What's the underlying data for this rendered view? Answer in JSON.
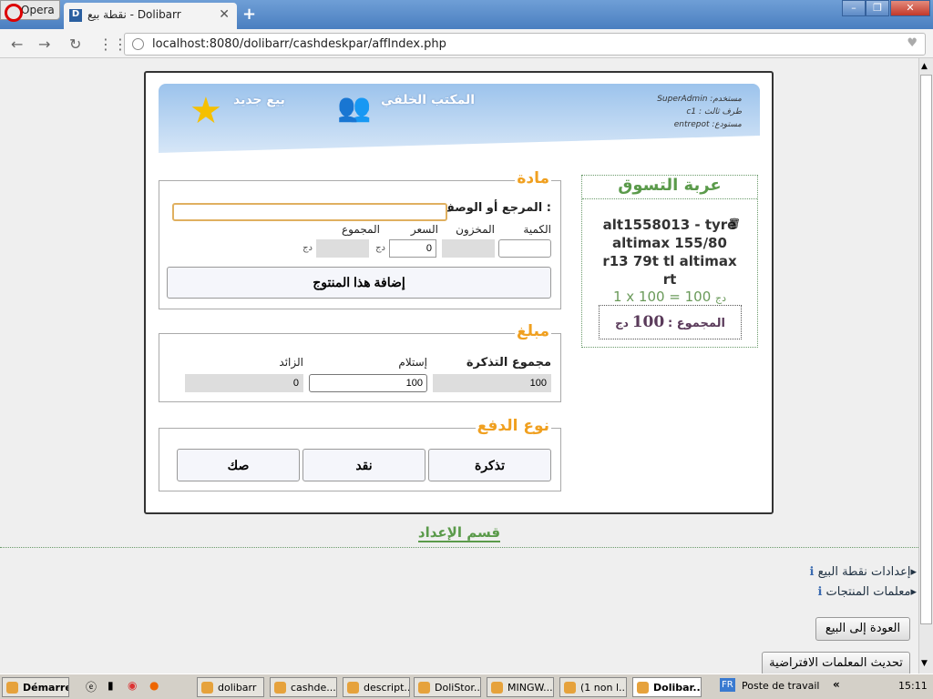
{
  "browser": {
    "opera_label": "Opera",
    "tab_title": "نقطة بيع - Dolibarr",
    "tab_favicon": "D",
    "url": "localhost:8080/dolibarr/cashdeskpar/affIndex.php"
  },
  "header": {
    "new_sale": "بيع جديد",
    "back_office": "المكتب الخلفي",
    "user_label": "مستخدم:",
    "user": "SuperAdmin",
    "thirdparty_label": "طرف ثالث :",
    "thirdparty": "c1",
    "warehouse_label": "مستودع:",
    "warehouse": "entrepot"
  },
  "article": {
    "legend": "مادة",
    "ref_label": "المرجع أو الوصف :",
    "ref_value": "",
    "qty_label": "الكمية",
    "stock_label": "المخزون",
    "price_label": "السعر",
    "total_label": "المجموع",
    "price_value": "0",
    "currency": "دج",
    "add_button": "إضافة هذا المنتوج"
  },
  "amount": {
    "legend": "مبلغ",
    "ticket_total_label": "مجموع التذكرة",
    "received_label": "إستلام",
    "change_label": "الزائد",
    "ticket_total": "100",
    "received": "100",
    "change": "0"
  },
  "payment": {
    "legend": "نوع الدفع",
    "buttons": [
      "تذكرة",
      "نقد",
      "صك"
    ]
  },
  "cart": {
    "title": "عربة التسوق",
    "item": "alt1558013 - tyre altimax 155/80 r13 79t tl altimax rt",
    "line": "1 x 100 = 100",
    "currency": "دج",
    "total_label": "المجموع :",
    "total": "100"
  },
  "setup": {
    "title": "قسم الإعداد",
    "links": [
      "إعدادات نقطة البيع",
      "معلمات المنتجات"
    ],
    "back_button": "العودة إلى البيع",
    "refresh_button": "تحديث المعلمات الافتراضية"
  },
  "taskbar": {
    "start": "Démarrer",
    "items": [
      "dolibarr",
      "cashde...",
      "descript...",
      "DoliStor...",
      "MINGW...",
      "(1 non l...",
      "Dolibar..."
    ],
    "lang": "FR",
    "desktop": "Poste de travail",
    "clock": "15:11"
  }
}
